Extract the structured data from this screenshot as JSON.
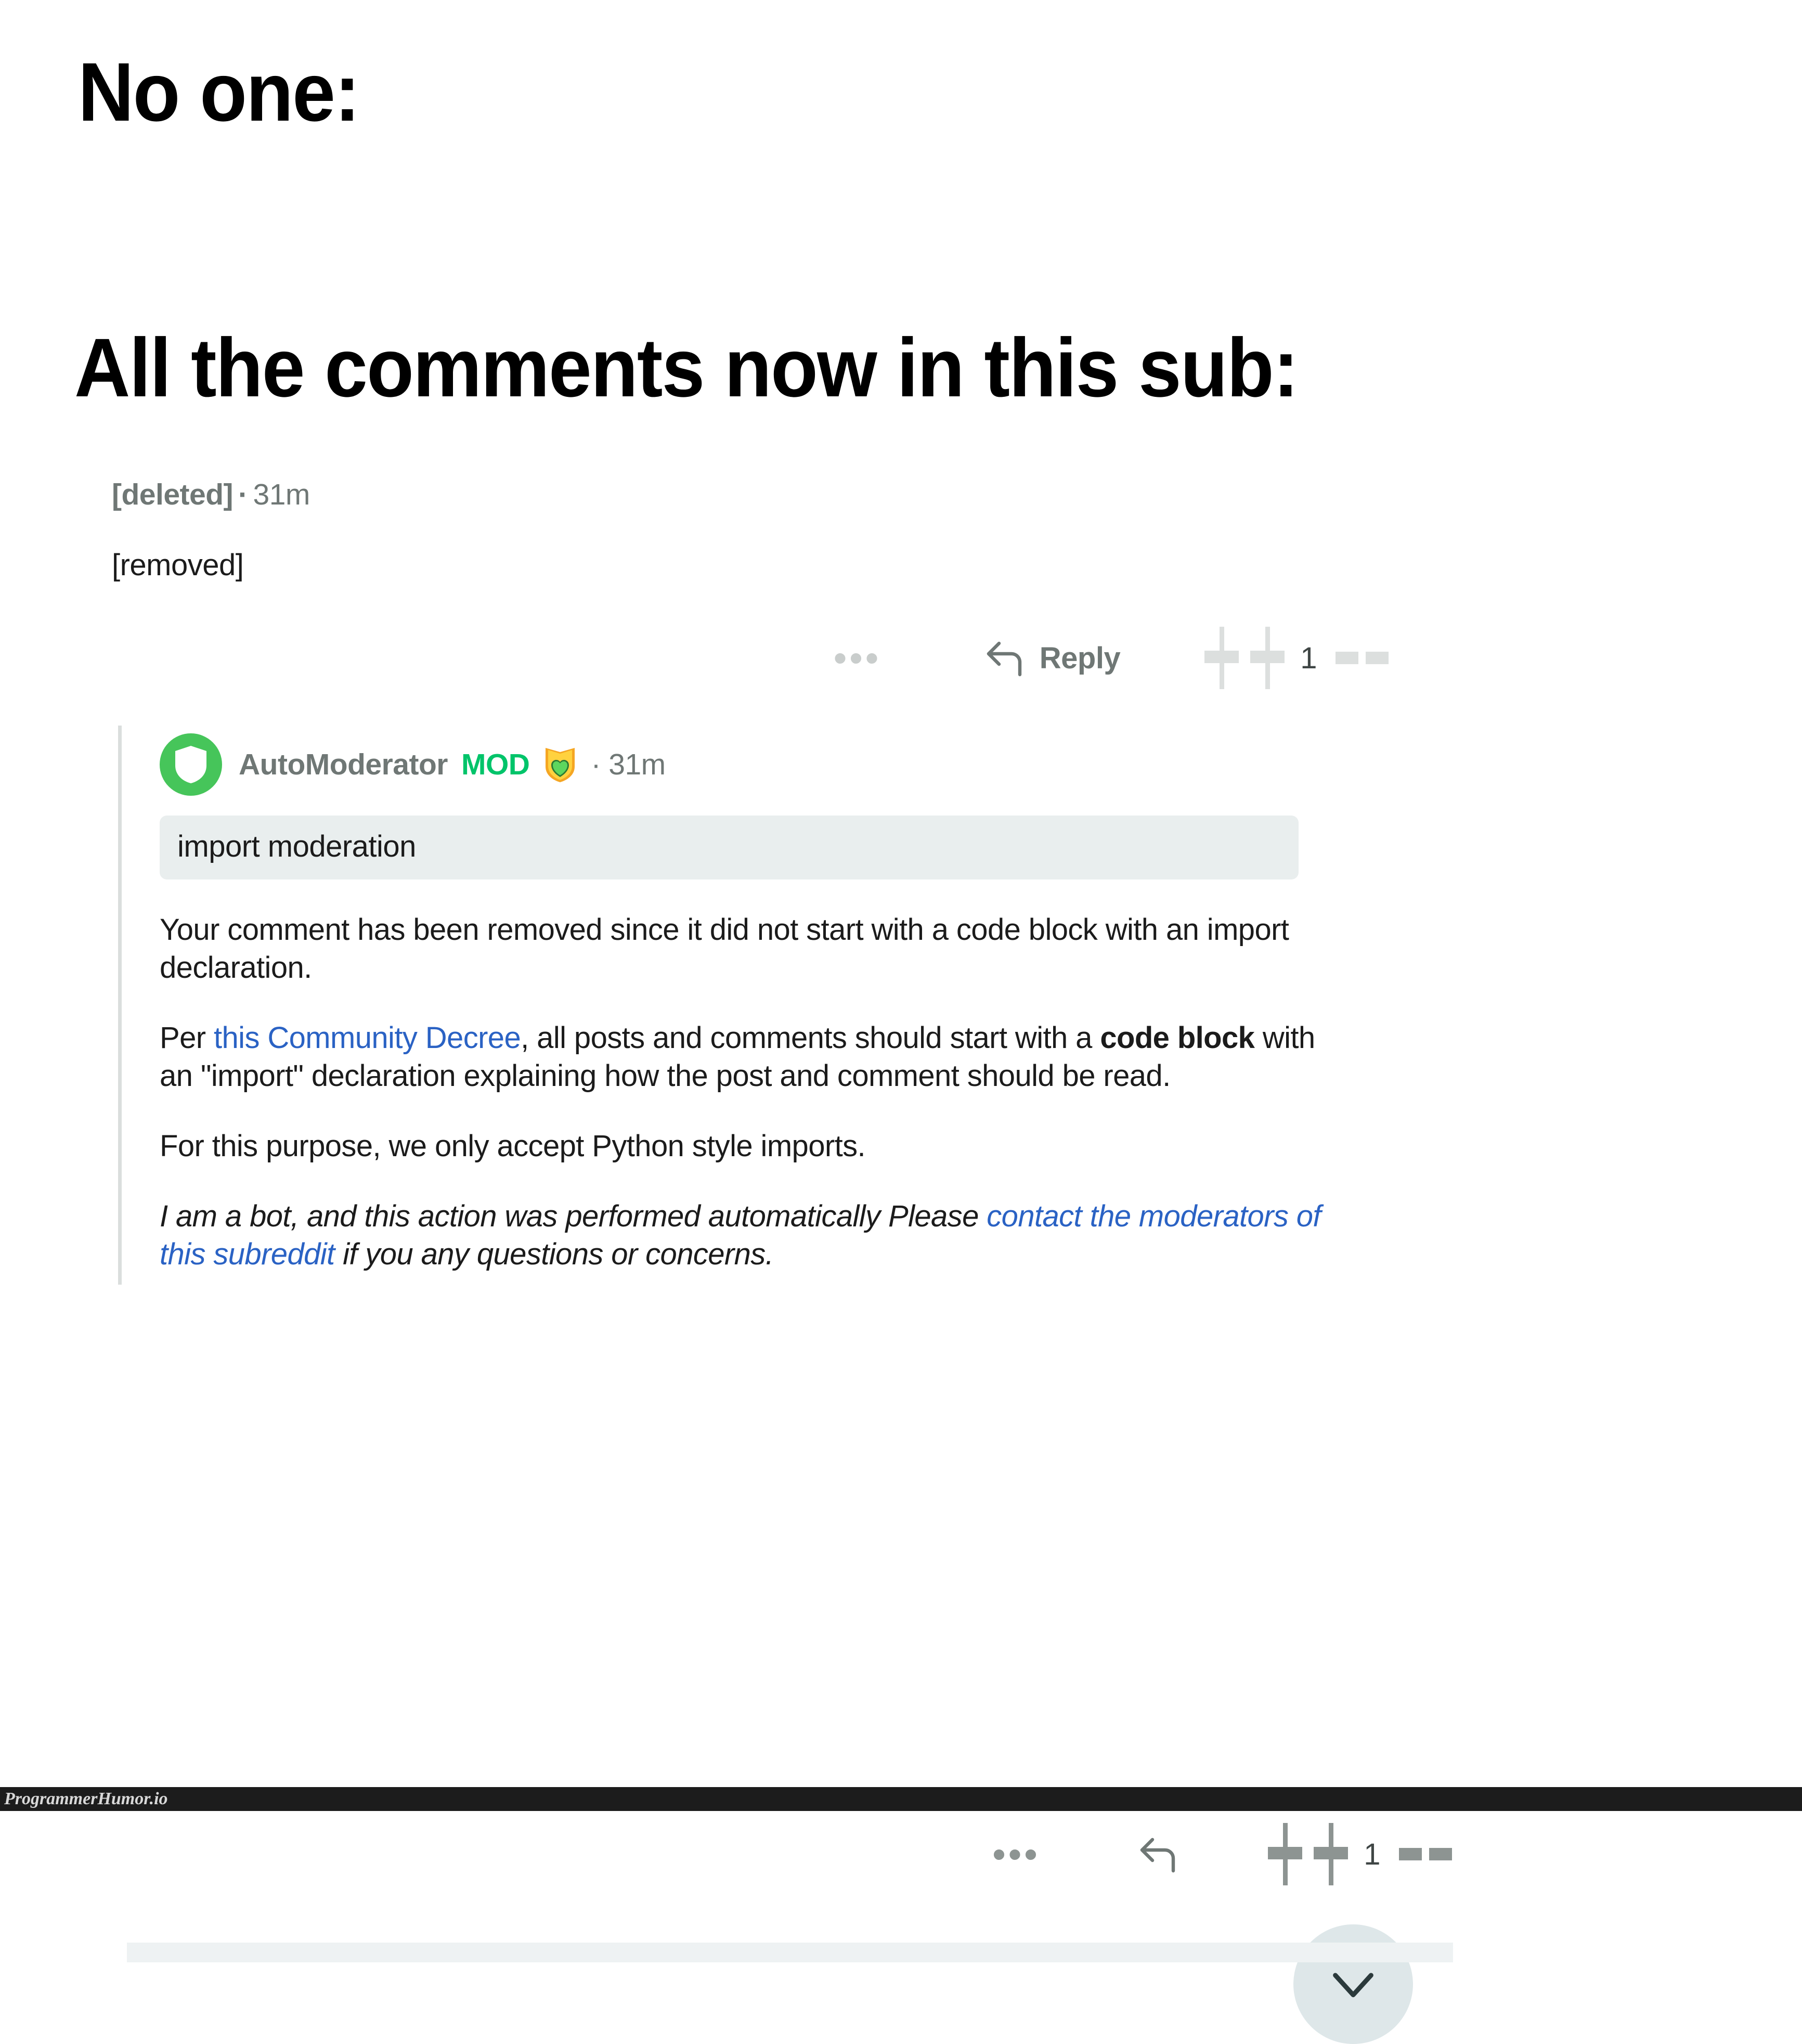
{
  "meme": {
    "setup_line": "No one:",
    "punchline": "All the comments now in this sub:"
  },
  "deleted_comment": {
    "author": "[deleted]",
    "separator": "·",
    "timestamp": "31m",
    "body": "[removed]",
    "actions": {
      "overflow_label": "•••",
      "reply_label": "Reply",
      "vote_count": "1"
    }
  },
  "automod_comment": {
    "author": "AutoModerator",
    "mod_tag": "MOD",
    "award_icon": "shield-heart-award-icon",
    "separator": "·",
    "timestamp": "31m",
    "code_block": "import moderation",
    "paragraphs": {
      "p1": "Your comment has been removed since it did not start with a code block with an import declaration.",
      "p2_prefix": "Per ",
      "p2_link": "this Community Decree",
      "p2_mid1": ", all posts and comments should start with a ",
      "p2_bold": "code block",
      "p2_mid2": " with an \"import\" declaration explaining how the post and comment should be read.",
      "p3": "For this purpose, we only accept Python style imports.",
      "p4_prefix": "I am a bot, and this action was performed automatically Please ",
      "p4_link": "contact the moderators of this subreddit",
      "p4_suffix": " if you any questions or concerns."
    },
    "actions": {
      "overflow_label": "•••",
      "vote_count": "1"
    },
    "collapse_icon": "chevron-down-icon"
  },
  "watermark": {
    "text": "ProgrammerHumor.io"
  },
  "colors": {
    "link": "#2a62c4",
    "mod_green": "#00c46a",
    "avatar_green": "#46c55a",
    "muted_text": "#6f7775",
    "code_bg": "#e9eeee",
    "collapse_bg": "#dee7e9",
    "thread_line": "#dadedd"
  }
}
